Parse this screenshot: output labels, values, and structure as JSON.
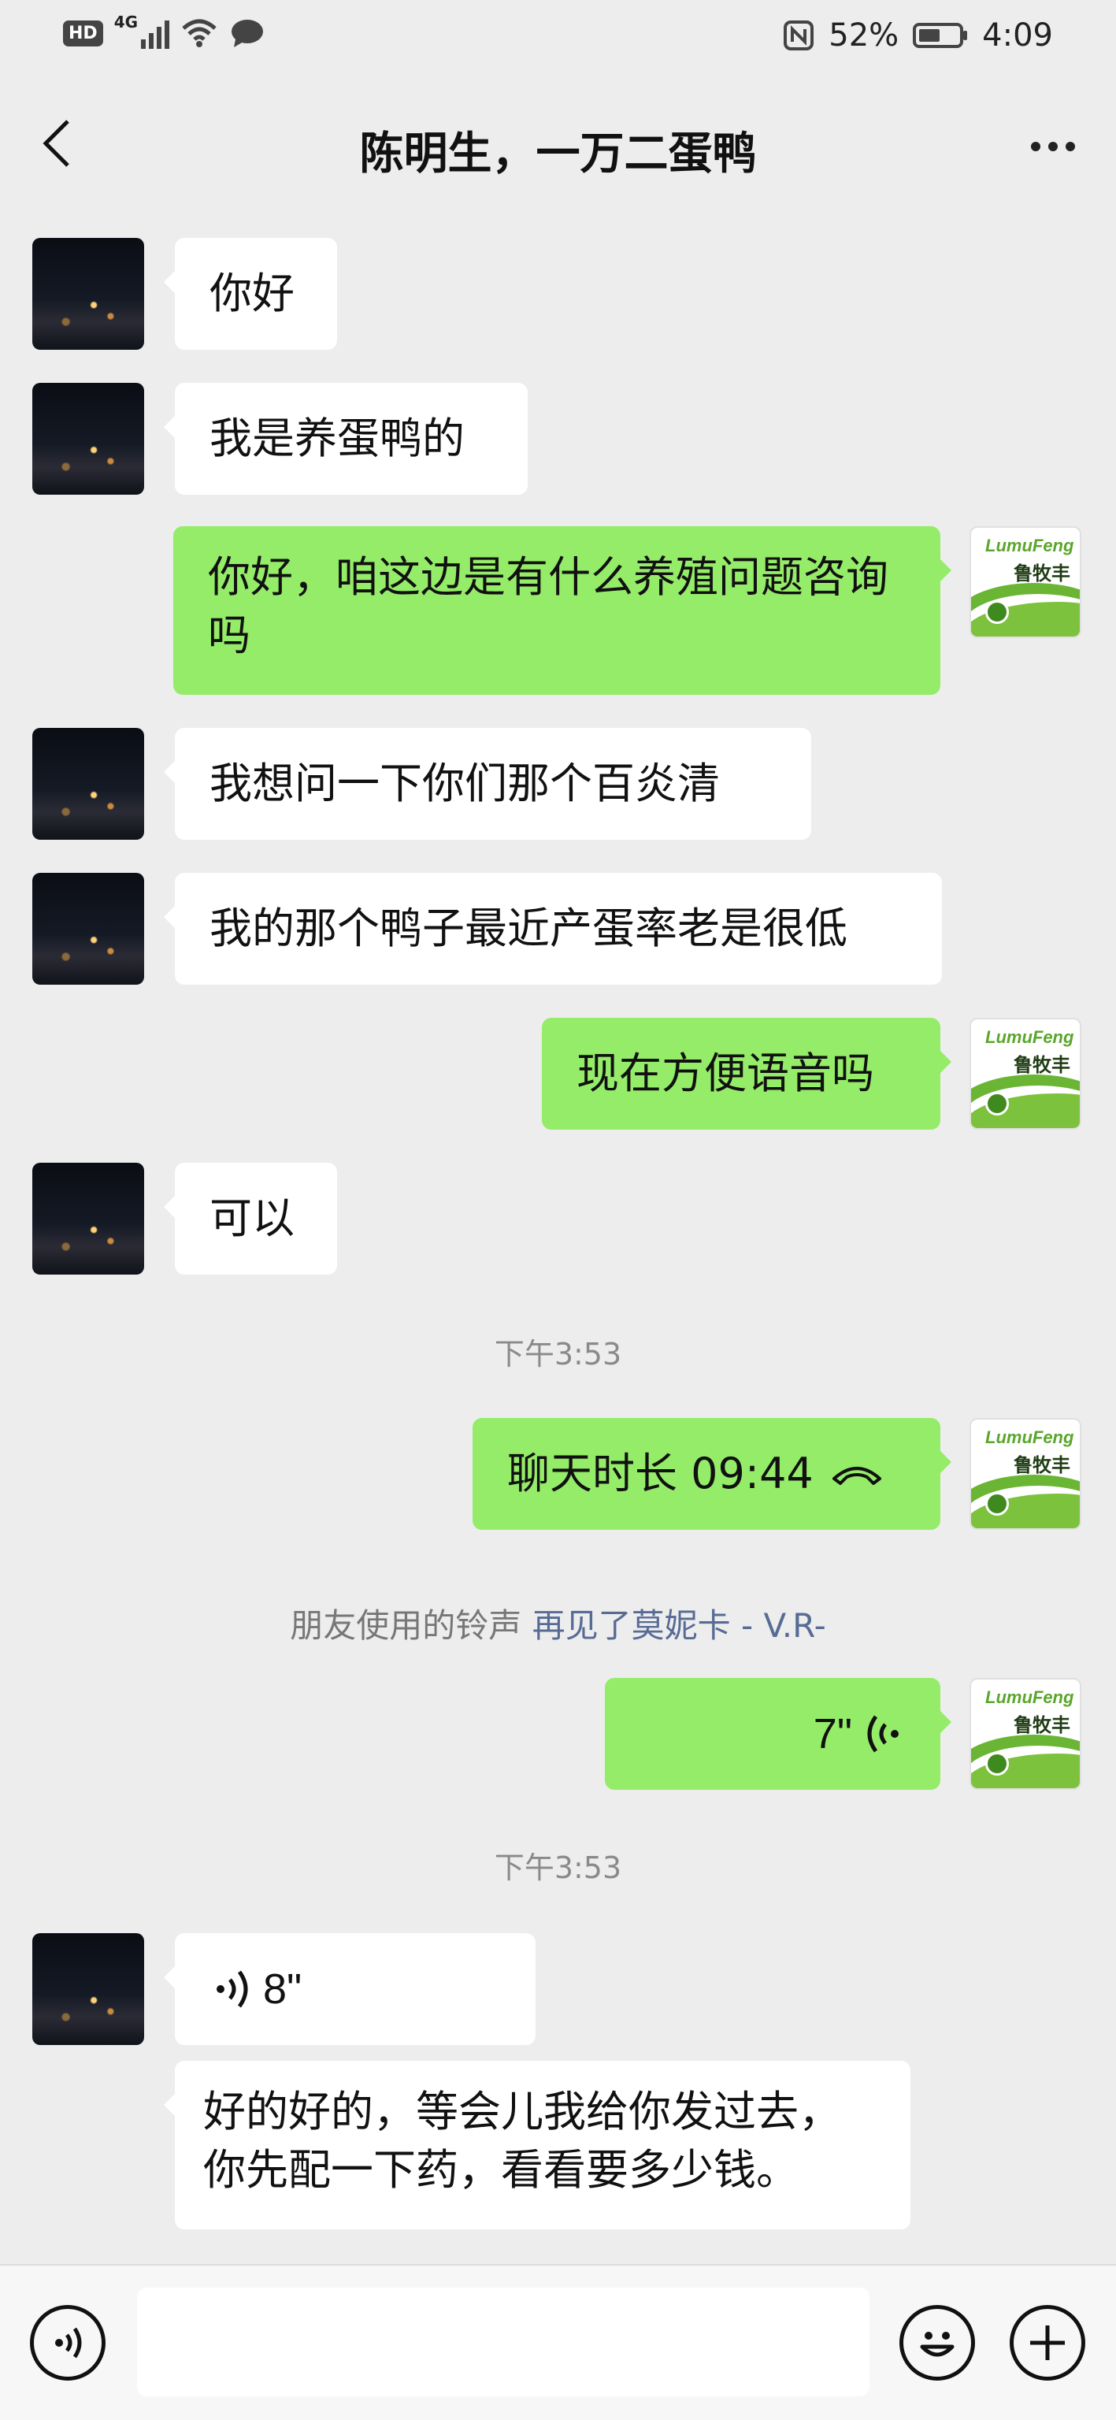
{
  "status_bar": {
    "hd": "HD",
    "network": "4G",
    "battery": "52%",
    "time": "4:09"
  },
  "header": {
    "title": "陈明生，一万二蛋鸭"
  },
  "brand_avatar": {
    "brand_text": "LumuFeng",
    "cn_text": "鲁牧丰"
  },
  "messages": [
    {
      "side": "in",
      "text": "你好"
    },
    {
      "side": "in",
      "text": "我是养蛋鸭的"
    },
    {
      "side": "out",
      "text": "你好，咱这边是有什么养殖问题咨询吗"
    },
    {
      "side": "in",
      "text": "我想问一下你们那个百炎清"
    },
    {
      "side": "in",
      "text": "我的那个鸭子最近产蛋率老是很低"
    },
    {
      "side": "out",
      "text": "现在方便语音吗"
    },
    {
      "side": "in",
      "text": "可以"
    }
  ],
  "timestamp_1": "下午3:53",
  "call": {
    "label": "聊天时长 09:44"
  },
  "ringtone": {
    "prefix": "朋友使用的铃声",
    "song": "再见了莫妮卡 - V.R-"
  },
  "voice_out": {
    "duration": "7\""
  },
  "timestamp_2": "下午3:53",
  "voice_in": {
    "duration": "8\""
  },
  "last_message": {
    "line1": "好的好的，等会儿我给你发过去，",
    "line2": "你先配一下药，看看要多少钱。"
  },
  "colors": {
    "outgoing_bubble": "#95ec69",
    "incoming_bubble": "#ffffff",
    "background": "#ededed",
    "link": "#576b95"
  }
}
